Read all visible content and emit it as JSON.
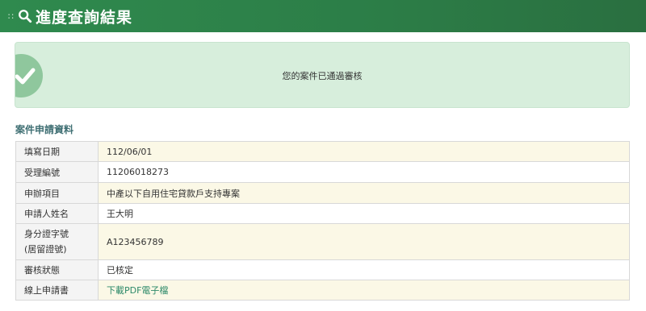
{
  "header": {
    "title": "進度查詢結果",
    "icon": "search-icon"
  },
  "alert": {
    "message": "您的案件已通過審核",
    "icon": "check-circle-icon"
  },
  "section": {
    "title": "案件申請資料"
  },
  "rows": [
    {
      "label": "填寫日期",
      "value": "112/06/01"
    },
    {
      "label": "受理編號",
      "value": "11206018273"
    },
    {
      "label": "申辦項目",
      "value": "中產以下自用住宅貸款戶支持專案"
    },
    {
      "label": "申請人姓名",
      "value": "王大明"
    },
    {
      "label": "身分證字號",
      "label2": "(居留證號)",
      "value": "A123456789"
    },
    {
      "label": "審核狀態",
      "value": "已核定"
    },
    {
      "label": "線上申請書",
      "value": "下載PDF電子檔"
    }
  ],
  "colors": {
    "header": "#2f8a4e",
    "alert_bg": "#d7eedc",
    "link": "#2e8a6a",
    "section_title": "#3f6f73"
  }
}
